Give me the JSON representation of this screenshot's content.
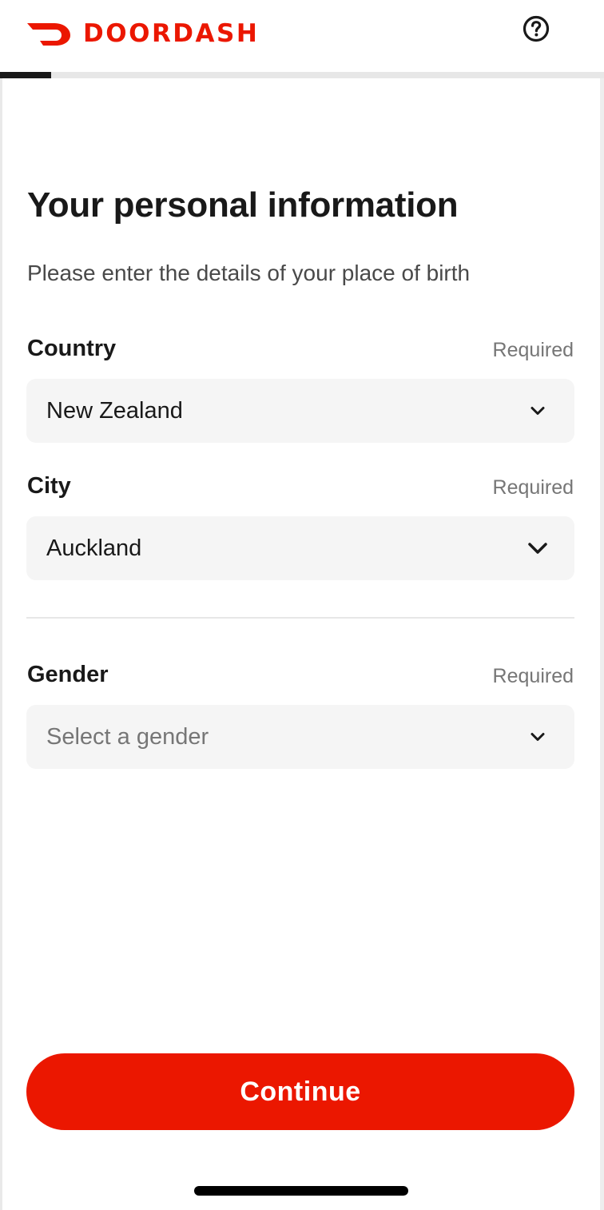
{
  "header": {
    "brand": "DOORDASH",
    "logo_icon": "doordash-logo-icon",
    "help_icon": "help-circle-icon",
    "progress_fraction": 0.085
  },
  "colors": {
    "brand": "#eb1700",
    "text": "#191919",
    "muted": "#767676",
    "field_bg": "#f5f5f5"
  },
  "main": {
    "title": "Your personal information",
    "subtitle": "Please enter the details of your place of birth",
    "fields": [
      {
        "label": "Country",
        "required": "Required",
        "value": "New Zealand",
        "placeholder": ""
      },
      {
        "label": "City",
        "required": "Required",
        "value": "Auckland",
        "placeholder": ""
      },
      {
        "label": "Gender",
        "required": "Required",
        "value": "",
        "placeholder": "Select a gender"
      }
    ],
    "chevron_icon": "chevron-down-icon"
  },
  "footer": {
    "continue_label": "Continue"
  }
}
